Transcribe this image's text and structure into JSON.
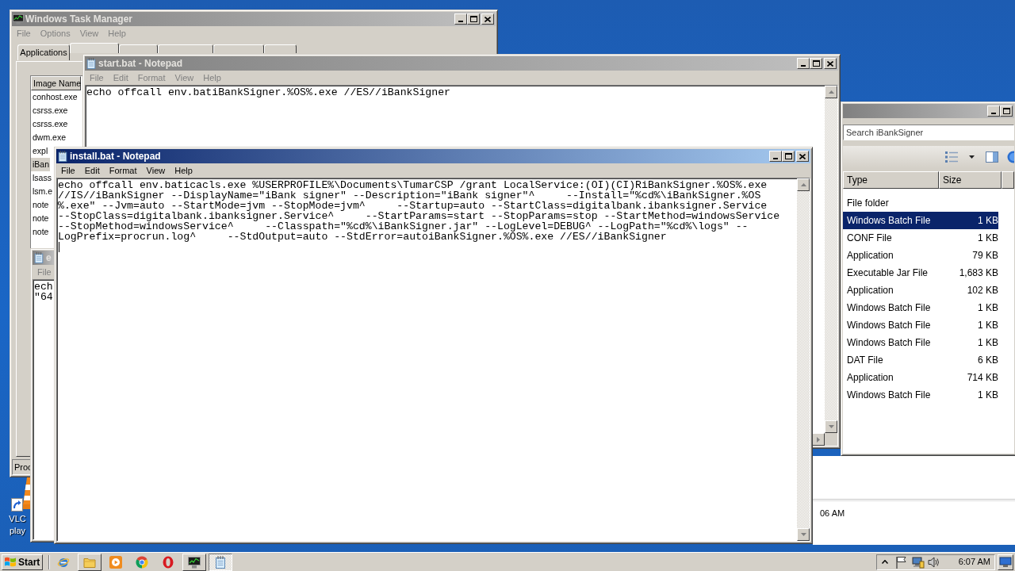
{
  "desktop_shortcut": {
    "label": "VLC\nplay"
  },
  "task_manager": {
    "title": "Windows Task Manager",
    "active": false,
    "menu": [
      "File",
      "Options",
      "View",
      "Help"
    ],
    "tabs": [
      {
        "label": "Applications",
        "selected": false
      },
      {
        "selected": true
      },
      {
        "selected": false
      },
      {
        "selected": false
      },
      {
        "selected": false
      },
      {
        "selected": false
      }
    ],
    "columns": [
      "Image Name"
    ],
    "processes": [
      {
        "name": "conhost.exe",
        "selected": false
      },
      {
        "name": "csrss.exe",
        "selected": false
      },
      {
        "name": "csrss.exe",
        "selected": false
      },
      {
        "name": "dwm.exe",
        "selected": false
      },
      {
        "name": "expl",
        "selected": false
      },
      {
        "name": "iBan",
        "selected": true
      },
      {
        "name": "lsass",
        "selected": false
      },
      {
        "name": "lsm.e",
        "selected": false
      },
      {
        "name": "note",
        "selected": false
      },
      {
        "name": "note",
        "selected": false
      },
      {
        "name": "note",
        "selected": false
      }
    ],
    "status_bar": "Proc"
  },
  "notepads": [
    {
      "title": "start.bat - Notepad",
      "active": false,
      "menu": [
        "File",
        "Edit",
        "Format",
        "View",
        "Help"
      ],
      "lines": [
        "echo offcall env.batiBankSigner.%OS%.exe //ES//iBankSigner"
      ],
      "caret": false
    },
    {
      "title": "e",
      "active": false,
      "menu": [
        "File"
      ],
      "lines": [
        "ech",
        "\"64"
      ],
      "caret": false
    },
    {
      "title": "install.bat - Notepad",
      "active": true,
      "menu": [
        "File",
        "Edit",
        "Format",
        "View",
        "Help"
      ],
      "lines": [
        "echo offcall env.baticacls.exe %USERPROFILE%\\Documents\\TumarCSP /grant LocalService:(OI)(CI)RiBankSigner.%OS%.exe",
        "//IS//iBankSigner --DisplayName=\"iBank signer\" --Description=\"iBank signer\"^     --Install=\"%cd%\\iBankSigner.%OS",
        "%.exe\" --Jvm=auto --StartMode=jvm --StopMode=jvm^     --Startup=auto --StartClass=digitalbank.ibanksigner.Service",
        "--StopClass=digitalbank.ibanksigner.Service^     --StartParams=start --StopParams=stop --StartMethod=windowsService",
        "--StopMethod=windowsService^     --Classpath=\"%cd%\\iBankSigner.jar\" --LogLevel=DEBUG^ --LogPath=\"%cd%\\logs\" --",
        "LogPrefix=procrun.log^     --StdOutput=auto --StdError=autoiBankSigner.%OS%.exe //ES//iBankSigner"
      ],
      "caret": true
    }
  ],
  "explorer": {
    "active": false,
    "search": {
      "placeholder": "Search iBankSigner"
    },
    "columns": [
      "Type",
      "Size"
    ],
    "files": [
      {
        "type": "File folder",
        "selected": false
      },
      {
        "type": "Windows Batch File",
        "size": "1 KB",
        "selected": true
      },
      {
        "type": "CONF File",
        "size": "1 KB",
        "selected": false
      },
      {
        "type": "Application",
        "size": "79 KB",
        "selected": false
      },
      {
        "type": "Executable Jar File",
        "size": "1,683 KB",
        "selected": false
      },
      {
        "type": "Application",
        "size": "102 KB",
        "selected": false
      },
      {
        "type": "Windows Batch File",
        "size": "1 KB",
        "selected": false
      },
      {
        "type": "Windows Batch File",
        "size": "1 KB",
        "selected": false
      },
      {
        "type": "Windows Batch File",
        "size": "1 KB",
        "selected": false
      },
      {
        "type": "DAT File",
        "size": "6 KB",
        "selected": false
      },
      {
        "type": "Application",
        "size": "714 KB",
        "selected": false
      },
      {
        "type": "Windows Batch File",
        "size": "1 KB",
        "selected": false
      }
    ]
  },
  "background_window": {
    "text": "06 AM"
  },
  "taskbar": {
    "start": "Start",
    "items": [
      {
        "kind": "e_logo",
        "running": false,
        "selected": false
      },
      {
        "kind": "folder",
        "running": true,
        "selected": false
      },
      {
        "kind": "media",
        "running": false,
        "selected": false
      },
      {
        "kind": "round_logo",
        "running": false,
        "selected": false
      },
      {
        "kind": "ring_logo",
        "running": false,
        "selected": false
      },
      {
        "kind": "monitor",
        "running": true,
        "selected": false
      },
      {
        "kind": "notepad",
        "running": true,
        "selected": true
      }
    ],
    "clock": "6:07 AM"
  }
}
